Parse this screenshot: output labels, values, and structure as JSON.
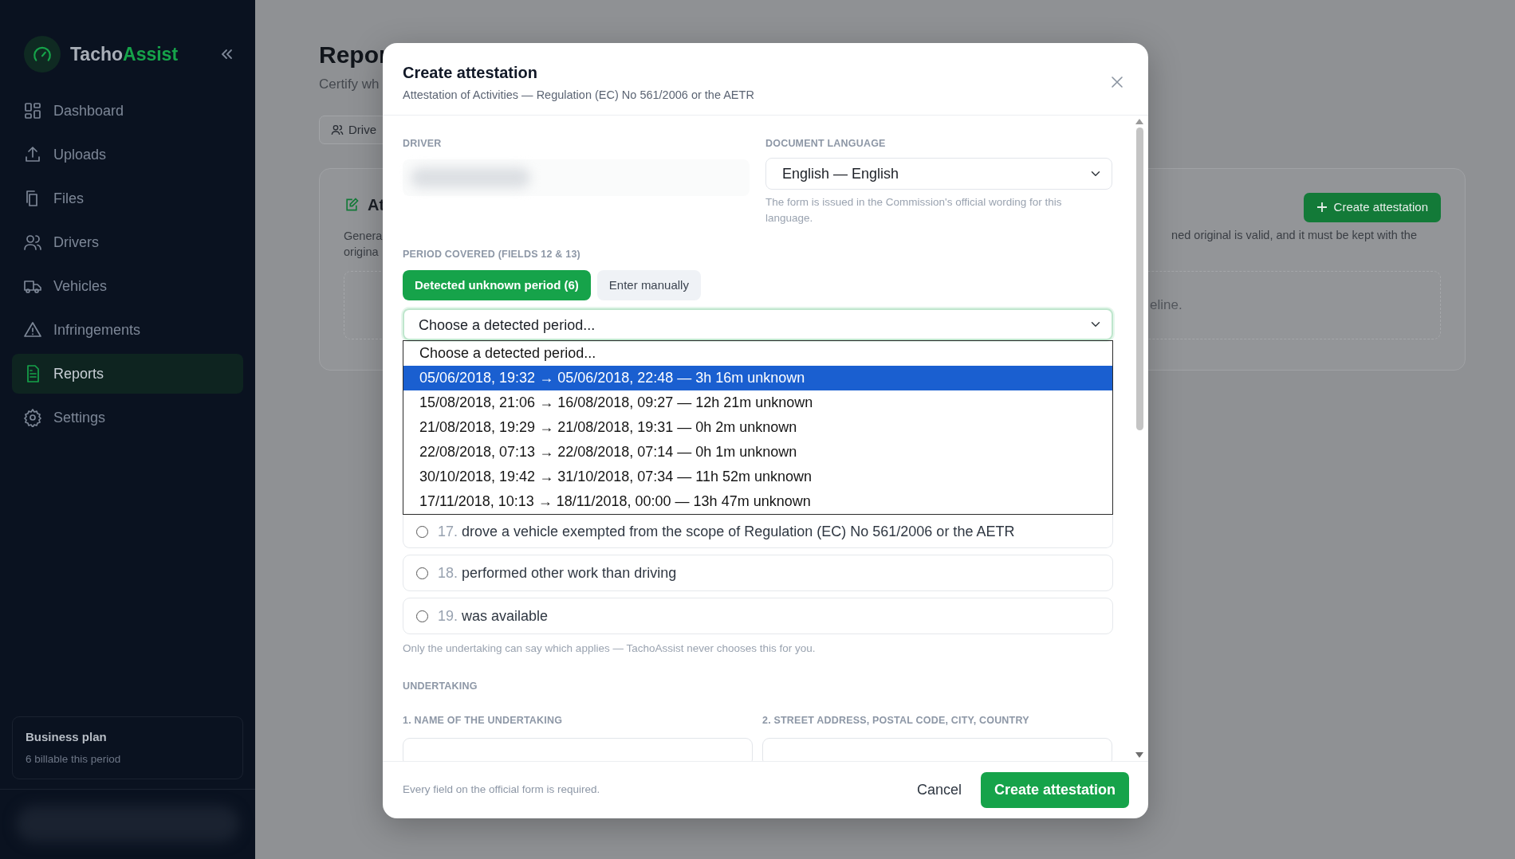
{
  "sidebar": {
    "brand": {
      "first": "Tacho",
      "second": "Assist"
    },
    "items": [
      {
        "label": "Dashboard",
        "selected": false
      },
      {
        "label": "Uploads",
        "selected": false
      },
      {
        "label": "Files",
        "selected": false
      },
      {
        "label": "Drivers",
        "selected": false
      },
      {
        "label": "Vehicles",
        "selected": false
      },
      {
        "label": "Infringements",
        "selected": false
      },
      {
        "label": "Reports",
        "selected": true
      },
      {
        "label": "Settings",
        "selected": false
      }
    ],
    "plan": {
      "title": "Business plan",
      "detail": "6 billable this period"
    }
  },
  "page": {
    "title": "Repor",
    "subtitle": "Certify wh",
    "filter_button": "Drive",
    "card": {
      "title": "At",
      "text_lines": [
        "Genera",
        "origina"
      ],
      "right_text": "ned original is valid, and it must be kept with the",
      "empty_text": "eline.",
      "button": "Create attestation"
    }
  },
  "modal": {
    "title": "Create attestation",
    "subtitle": "Attestation of Activities — Regulation (EC) No 561/2006 or the AETR",
    "driver_label": "DRIVER",
    "language": {
      "label": "DOCUMENT LANGUAGE",
      "value": "English — English",
      "hint": "The form is issued in the Commission's official wording for this language."
    },
    "period": {
      "label": "PERIOD COVERED (FIELDS 12 & 13)",
      "tabs": [
        {
          "label": "Detected unknown period (6)",
          "selected": true
        },
        {
          "label": "Enter manually",
          "selected": false
        }
      ],
      "select_value": "Choose a detected period...",
      "options": [
        {
          "label": "Choose a detected period...",
          "selected": false
        },
        {
          "label": "05/06/2018, 19:32 → 05/06/2018, 22:48 — 3h 16m unknown",
          "selected": true
        },
        {
          "label": "15/08/2018, 21:06 → 16/08/2018, 09:27 — 12h 21m unknown",
          "selected": false
        },
        {
          "label": "21/08/2018, 19:29 → 21/08/2018, 19:31 — 0h 2m unknown",
          "selected": false
        },
        {
          "label": "22/08/2018, 07:13 → 22/08/2018, 07:14 — 0h 1m unknown",
          "selected": false
        },
        {
          "label": "30/10/2018, 19:42 → 31/10/2018, 07:34 — 11h 52m unknown",
          "selected": false
        },
        {
          "label": "17/11/2018, 10:13 → 18/11/2018, 00:00 — 13h 47m unknown",
          "selected": false
        }
      ]
    },
    "reasons": [
      {
        "number": "17.",
        "text": "drove a vehicle exempted from the scope of Regulation (EC) No 561/2006 or the AETR",
        "selected": false
      },
      {
        "number": "18.",
        "text": "performed other work than driving",
        "selected": false
      },
      {
        "number": "19.",
        "text": "was available",
        "selected": false
      }
    ],
    "reasons_note": "Only the undertaking can say which applies — TachoAssist never chooses this for you.",
    "undertaking": {
      "heading": "UNDERTAKING",
      "fields": [
        {
          "label": "1. NAME OF THE UNDERTAKING"
        },
        {
          "label": "2. STREET ADDRESS, POSTAL CODE, CITY, COUNTRY"
        }
      ]
    },
    "footer_note": "Every field on the official form is required.",
    "cancel": "Cancel",
    "submit": "Create attestation"
  }
}
